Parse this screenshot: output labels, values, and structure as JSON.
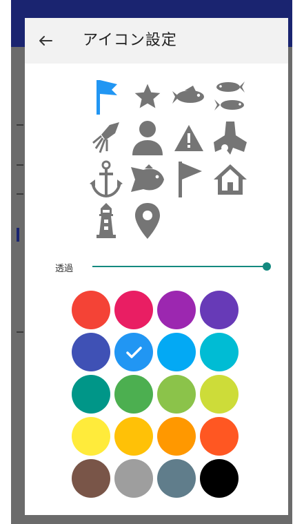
{
  "dialog": {
    "title": "アイコン設定",
    "back_icon": "arrow-left-icon"
  },
  "icons": [
    {
      "name": "flag-icon",
      "selected": true
    },
    {
      "name": "star-icon",
      "selected": false
    },
    {
      "name": "fish-icon",
      "selected": false
    },
    {
      "name": "two-fish-icon",
      "selected": false
    },
    {
      "name": "squid-icon",
      "selected": false
    },
    {
      "name": "person-icon",
      "selected": false
    },
    {
      "name": "warning-icon",
      "selected": false
    },
    {
      "name": "tetrapod-icon",
      "selected": false
    },
    {
      "name": "anchor-icon",
      "selected": false
    },
    {
      "name": "sea-bream-icon",
      "selected": false
    },
    {
      "name": "pennant-flag-icon",
      "selected": false
    },
    {
      "name": "house-icon",
      "selected": false
    },
    {
      "name": "lighthouse-icon",
      "selected": false
    },
    {
      "name": "map-pin-icon",
      "selected": false
    }
  ],
  "opacity": {
    "label": "透過",
    "value": 1.0
  },
  "colors": {
    "selected_index": 5,
    "swatches": [
      "#F44336",
      "#E91E63",
      "#9C27B0",
      "#673AB7",
      "#3F51B5",
      "#2196F3",
      "#03A9F4",
      "#00BCD4",
      "#009688",
      "#4CAF50",
      "#8BC34A",
      "#CDDC39",
      "#FFEB3B",
      "#FFC107",
      "#FF9800",
      "#FF5722",
      "#795548",
      "#9E9E9E",
      "#607D8B",
      "#000000"
    ],
    "icon_selected": "#2196F3",
    "icon_default": "#757575",
    "accent": "#13897F"
  }
}
